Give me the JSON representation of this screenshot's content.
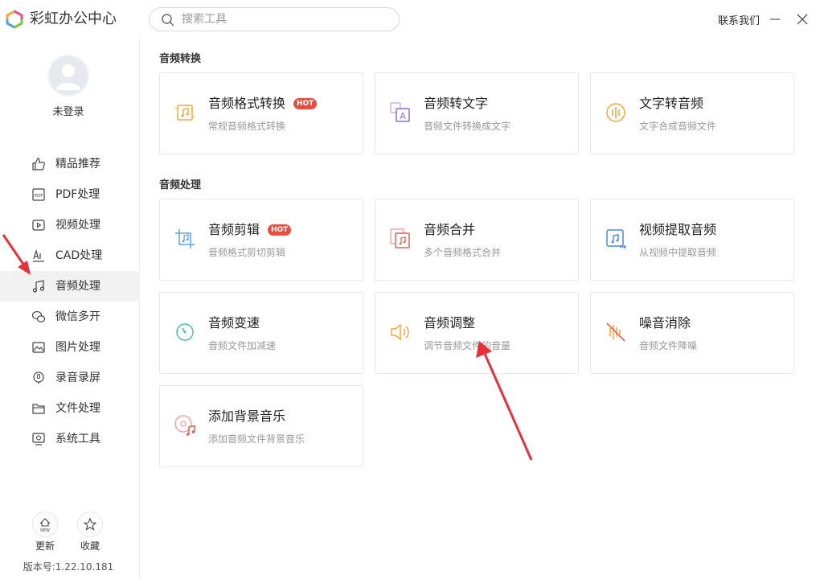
{
  "app": {
    "title": "彩虹办公中心"
  },
  "search": {
    "placeholder": "搜索工具"
  },
  "header": {
    "contact": "联系我们"
  },
  "user": {
    "status": "未登录"
  },
  "sidebar": {
    "items": [
      {
        "label": "精品推荐",
        "icon": "thumbs-up-icon"
      },
      {
        "label": "PDF处理",
        "icon": "pdf-icon"
      },
      {
        "label": "视频处理",
        "icon": "video-icon"
      },
      {
        "label": "CAD处理",
        "icon": "cad-icon"
      },
      {
        "label": "音频处理",
        "icon": "music-note-icon",
        "active": true
      },
      {
        "label": "微信多开",
        "icon": "wechat-icon"
      },
      {
        "label": "图片处理",
        "icon": "image-icon"
      },
      {
        "label": "录音录屏",
        "icon": "record-icon"
      },
      {
        "label": "文件处理",
        "icon": "folder-icon"
      },
      {
        "label": "系统工具",
        "icon": "system-tool-icon"
      }
    ],
    "update_label": "更新",
    "update_badge": "NEW",
    "favorite_label": "收藏",
    "version": "版本号:1.22.10.181"
  },
  "sections": [
    {
      "title": "音频转换",
      "cards": [
        {
          "title": "音频格式转换",
          "desc": "常规音频格式转换",
          "hot": "HOT",
          "icon": "audio-convert-icon"
        },
        {
          "title": "音频转文字",
          "desc": "音频文件转换成文字",
          "icon": "audio-to-text-icon"
        },
        {
          "title": "文字转音频",
          "desc": "文字合成音频文件",
          "icon": "text-to-audio-icon"
        }
      ]
    },
    {
      "title": "音频处理",
      "cards": [
        {
          "title": "音频剪辑",
          "desc": "音频格式剪切剪辑",
          "hot": "HOT",
          "icon": "audio-crop-icon"
        },
        {
          "title": "音频合并",
          "desc": "多个音频格式合并",
          "icon": "audio-merge-icon"
        },
        {
          "title": "视频提取音频",
          "desc": "从视频中提取音频",
          "icon": "video-extract-audio-icon"
        },
        {
          "title": "音频变速",
          "desc": "音频文件加减速",
          "icon": "speed-icon"
        },
        {
          "title": "音频调整",
          "desc": "调节音频文件的音量",
          "icon": "volume-icon"
        },
        {
          "title": "噪音消除",
          "desc": "音频文件降噪",
          "icon": "noise-cancel-icon"
        },
        {
          "title": "添加背景音乐",
          "desc": "添加音频文件背景音乐",
          "icon": "background-music-icon"
        }
      ]
    }
  ],
  "colors": {
    "hot_badge": "#e84d3d",
    "arrow": "#e8303a",
    "active_bg": "#f2f2f2"
  }
}
